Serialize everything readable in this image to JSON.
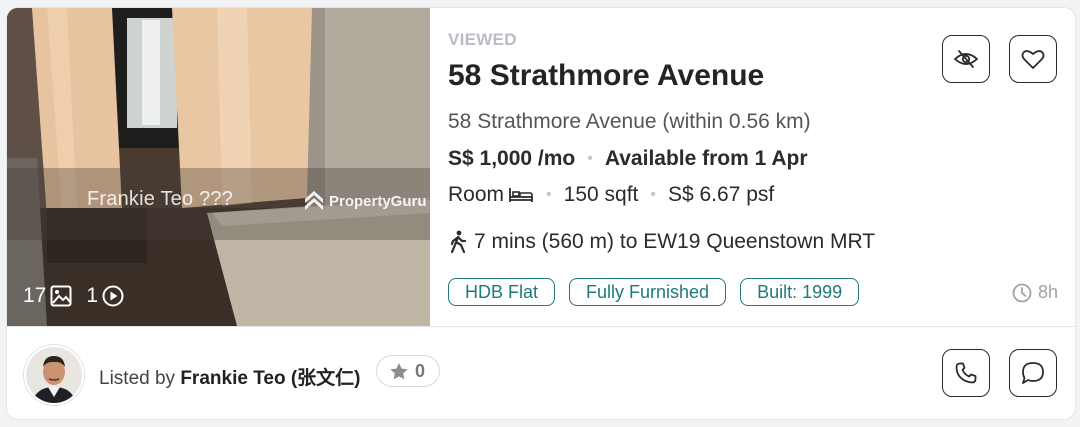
{
  "listing": {
    "status": "VIEWED",
    "title": "58 Strathmore Avenue",
    "address": "58 Strathmore Avenue (within 0.56 km)",
    "price": "S$ 1,000 /mo",
    "availability": "Available from 1 Apr",
    "room_type": "Room",
    "size": "150 sqft",
    "psf": "S$ 6.67 psf",
    "mrt": "7 mins (560 m) to EW19 Queenstown MRT",
    "tags": [
      "HDB Flat",
      "Fully Furnished",
      "Built: 1999"
    ],
    "posted_age": "8h"
  },
  "photo": {
    "watermark_agent": "Frankie Teo ???",
    "watermark_brand": "PropertyGuru",
    "photo_count": "17",
    "video_count": "1"
  },
  "agent": {
    "listed_by_prefix": "Listed by",
    "name": "Frankie Teo (张文仁)",
    "rating": "0"
  },
  "icons": {
    "hide": "eye-slash-icon",
    "favorite": "heart-icon",
    "photos": "image-icon",
    "video": "play-circle-icon",
    "room": "bed-icon",
    "walk": "walking-person-icon",
    "time": "clock-icon",
    "star": "star-icon",
    "call": "phone-icon",
    "chat": "chat-bubble-icon"
  },
  "colors": {
    "accent": "#1f7a7c",
    "muted": "#b9bcc2"
  }
}
